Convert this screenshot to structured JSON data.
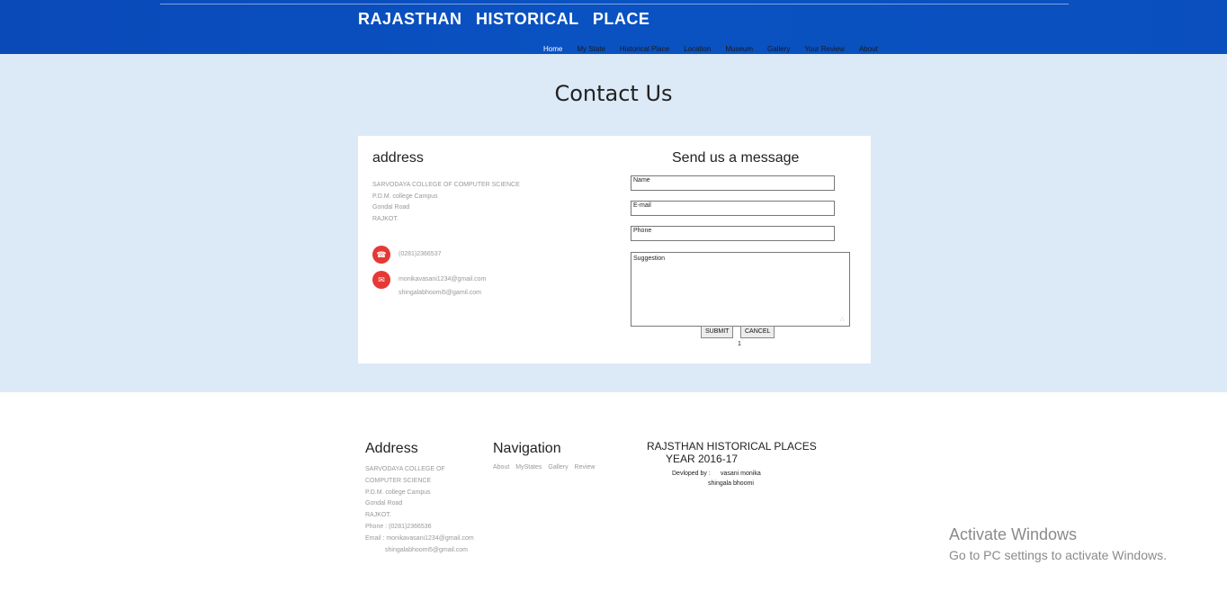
{
  "header": {
    "title": "RAJASTHAN HISTORICAL PLACE",
    "nav": [
      "Home",
      "My State",
      "Historical Place",
      "Location",
      "Museum",
      "Gallery",
      "Your Review",
      "About"
    ]
  },
  "main": {
    "page_title": "Contact Us",
    "address": {
      "title": "address",
      "lines": [
        "SARVODAYA COLLEGE OF COMPUTER SCIENCE",
        "P.D.M. college Campus",
        "Gondal Road",
        "RAJKOT."
      ],
      "phone": "(0281)2366537",
      "emails": [
        "monikavasani1234@gmail.com",
        "shingalabhoomi5@gamil.com"
      ]
    },
    "form": {
      "title": "Send us a message",
      "name_placeholder": "Name",
      "email_placeholder": "E-mail",
      "phone_placeholder": "Phone",
      "suggestion_placeholder": "Suggestion",
      "submit_label": "SUBMIT",
      "cancel_label": "CANCEL",
      "counter": "1"
    }
  },
  "footer": {
    "address_title": "Address",
    "address_lines": [
      "SARVODAYA COLLEGE OF",
      "COMPUTER SCIENCE",
      "P.D.M. college Campus",
      "Gondal Road",
      "RAJKOT.",
      "Phone : (0281)2366536",
      "Email : monikavasani1234@gmail.com",
      "shingalabhoomi5@gmail.com"
    ],
    "nav_title": "Navigation",
    "nav_links": [
      "About",
      "MyStates",
      "Gallery",
      "Review"
    ],
    "credit_line1": "RAJSTHAN HISTORICAL PLACES",
    "credit_line2": "YEAR 2016-17",
    "developed_by": "Devloped by :",
    "dev1": "vasani monika",
    "dev2": "shingala bhoomi"
  },
  "watermark": {
    "line1": "Activate Windows",
    "line2": "Go to PC settings to activate Windows."
  },
  "colors": {
    "header_blue": "#0a4fbd",
    "band": "#dce9f7",
    "icon_red": "#e53935"
  },
  "icons": [
    "phone-icon",
    "mail-icon",
    "resize-grip-icon"
  ]
}
